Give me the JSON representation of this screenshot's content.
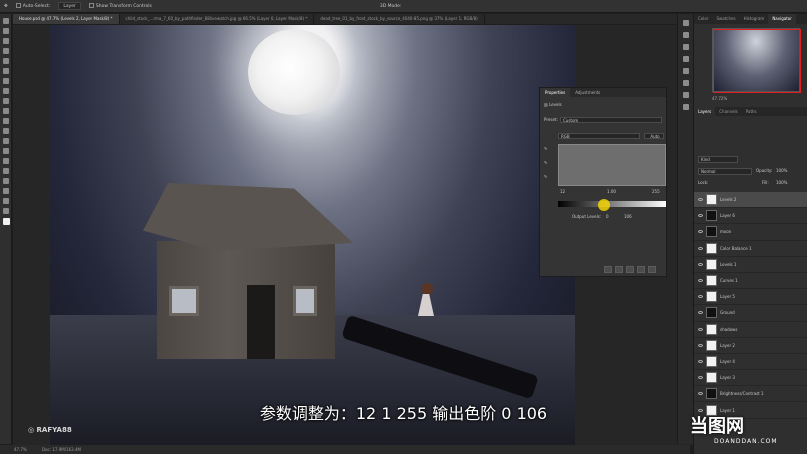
{
  "options_bar": {
    "auto_select_label": "Auto-Select:",
    "auto_select_value": "Layer",
    "transform_label": "Show Transform Controls",
    "mode_label": "3D Mode:"
  },
  "doc_tabs": [
    "House.psd @ 47.7% (Levels 2, Layer Mask/8) *",
    "child_stock_...rma_7_60_by_pathfinder_68livewatch.jpg @ 66.5% (Layer 0, Layer Mask/8) *",
    "dead_tree_01_by_frost_stock_by_source_4040-85.png @ 37% (Layer 1, RGB/8)"
  ],
  "toolbar_tools": [
    "move-icon",
    "marquee-icon",
    "lasso-icon",
    "quick-select-icon",
    "crop-icon",
    "eyedropper-icon",
    "healing-icon",
    "brush-icon",
    "stamp-icon",
    "history-brush-icon",
    "eraser-icon",
    "gradient-icon",
    "blur-icon",
    "dodge-icon",
    "pen-icon",
    "type-icon",
    "path-select-icon",
    "shape-icon",
    "hand-icon",
    "zoom-icon"
  ],
  "subtitle": "参数调整为：12 1 255  输出色阶 0 106",
  "watermark_left": "RAFYA88",
  "watermark_right": {
    "big": "当图网",
    "small": "DOANDDAN.COM"
  },
  "status": {
    "zoom": "47.7%",
    "doc": "Doc: 17.9M/163.4M"
  },
  "properties": {
    "tabs": [
      "Properties",
      "Adjustments"
    ],
    "panel_name": "Levels",
    "preset_label": "Preset:",
    "preset_value": "Custom",
    "channel_value": "RGB",
    "auto_label": "Auto",
    "input_values": [
      "12",
      "1.00",
      "255"
    ],
    "output_label": "Output Levels:",
    "output_values": [
      "0",
      "106"
    ]
  },
  "right_tabs": [
    "Color",
    "Swatches",
    "Histogram",
    "Navigator"
  ],
  "navigator_zoom": "47.72%",
  "layers_tabs": [
    "Layers",
    "Channels",
    "Paths"
  ],
  "layers_controls": {
    "kind": "Kind",
    "blend": "Normal",
    "opacity_label": "Opacity:",
    "opacity": "100%",
    "lock_label": "Lock:",
    "fill_label": "Fill:",
    "fill": "100%"
  },
  "layers": [
    {
      "name": "Levels 2",
      "thumb": "light",
      "selected": true
    },
    {
      "name": "Layer 6",
      "thumb": "dark",
      "selected": false
    },
    {
      "name": "moon",
      "thumb": "dark",
      "selected": false
    },
    {
      "name": "Color Balance 1",
      "thumb": "light",
      "selected": false
    },
    {
      "name": "Levels 1",
      "thumb": "light",
      "selected": false
    },
    {
      "name": "Curves 1",
      "thumb": "light",
      "selected": false
    },
    {
      "name": "Layer 5",
      "thumb": "light",
      "selected": false
    },
    {
      "name": "Ground",
      "thumb": "dark",
      "selected": false
    },
    {
      "name": "shadows",
      "thumb": "light",
      "selected": false
    },
    {
      "name": "Layer 2",
      "thumb": "light",
      "selected": false
    },
    {
      "name": "Layer 4",
      "thumb": "light",
      "selected": false
    },
    {
      "name": "Layer 3",
      "thumb": "light",
      "selected": false
    },
    {
      "name": "Brightness/Contrast 1",
      "thumb": "dark",
      "selected": false
    },
    {
      "name": "Layer 1",
      "thumb": "light",
      "selected": false
    }
  ]
}
